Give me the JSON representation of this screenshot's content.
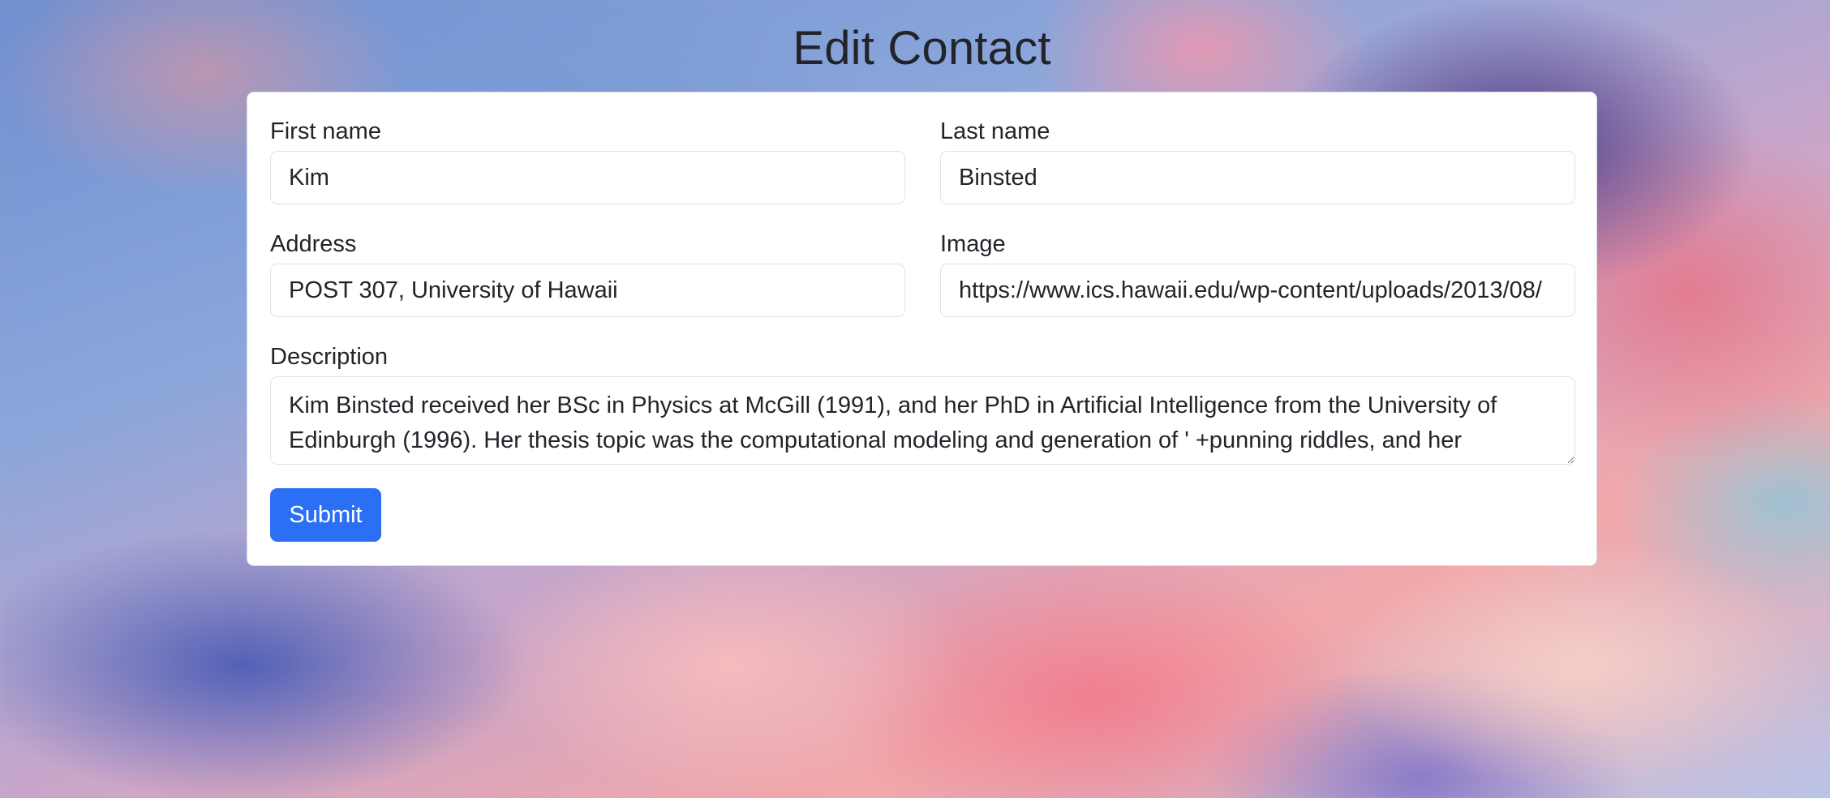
{
  "page": {
    "title": "Edit Contact"
  },
  "form": {
    "first_name": {
      "label": "First name",
      "value": "Kim"
    },
    "last_name": {
      "label": "Last name",
      "value": "Binsted"
    },
    "address": {
      "label": "Address",
      "value": "POST 307, University of Hawaii"
    },
    "image": {
      "label": "Image",
      "value": "https://www.ics.hawaii.edu/wp-content/uploads/2013/08/"
    },
    "description": {
      "label": "Description",
      "value": "Kim Binsted received her BSc in Physics at McGill (1991), and her PhD in Artificial Intelligence from the University of Edinburgh (1996). Her thesis topic was the computational modeling and generation of ' +punning riddles, and her program, JAPE (Joke Analysis and Production Engine), generated puns such as"
    },
    "submit_label": "Submit"
  },
  "colors": {
    "accent": "#2b6ff5",
    "text": "#212529",
    "border": "#dee2e6"
  }
}
